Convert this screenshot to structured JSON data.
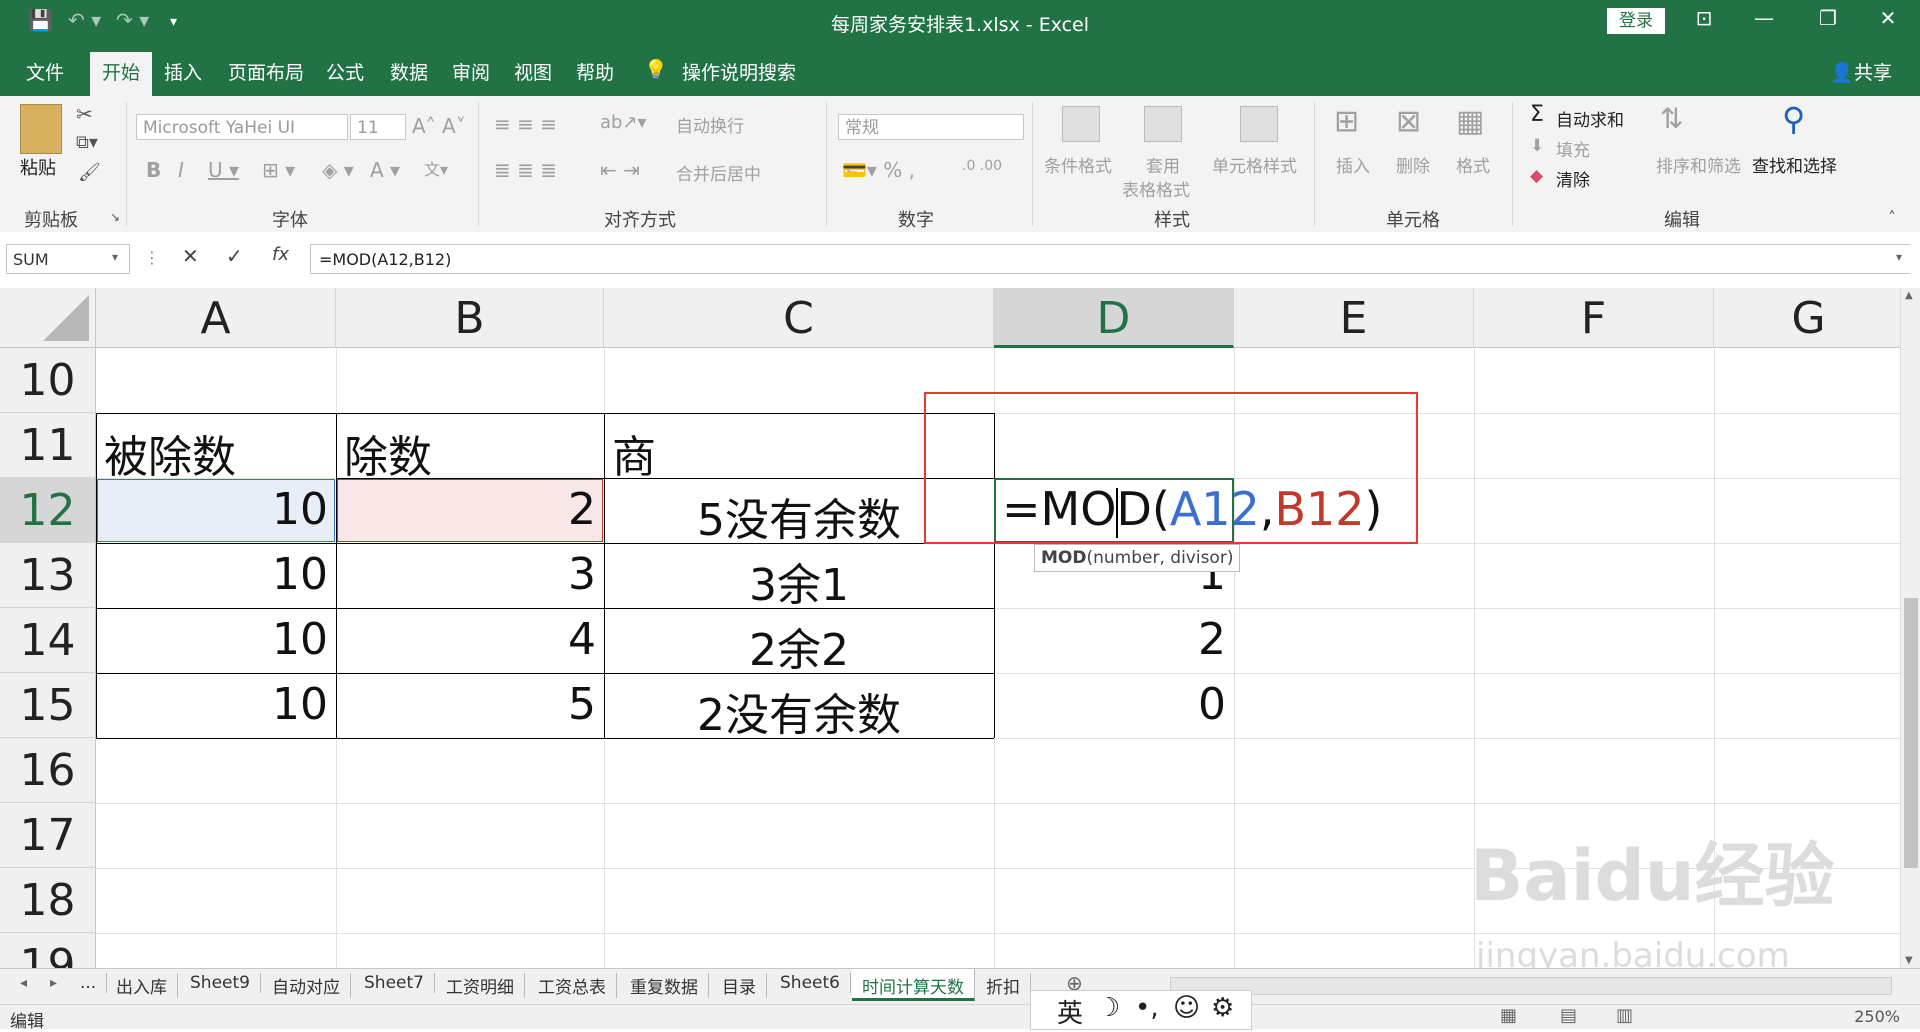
{
  "titlebar": {
    "title": "每周家务安排表1.xlsx  -  Excel",
    "login": "登录"
  },
  "menu": {
    "items": [
      "文件",
      "开始",
      "插入",
      "页面布局",
      "公式",
      "数据",
      "审阅",
      "视图",
      "帮助"
    ],
    "tell_me": "操作说明搜索",
    "share": "共享"
  },
  "ribbon": {
    "paste": "粘贴",
    "font_name": "Microsoft YaHei UI",
    "font_size": "11",
    "wrap_text": "自动换行",
    "merge_center": "合并后居中",
    "number_format": "常规",
    "cond_format": "条件格式",
    "table_format_1": "套用",
    "table_format_2": "表格格式",
    "cell_styles": "单元格样式",
    "insert": "插入",
    "delete": "删除",
    "format": "格式",
    "autosum": "自动求和",
    "fill": "填充",
    "clear": "清除",
    "sort_filter": "排序和筛选",
    "find_select": "查找和选择",
    "groups": {
      "clipboard": "剪贴板",
      "font": "字体",
      "alignment": "对齐方式",
      "number": "数字",
      "styles": "样式",
      "cells": "单元格",
      "editing": "编辑"
    }
  },
  "formula_bar": {
    "name_box": "SUM",
    "formula": "=MOD(A12,B12)"
  },
  "grid": {
    "columns": [
      "A",
      "B",
      "C",
      "D",
      "E",
      "F",
      "G"
    ],
    "rows": [
      "10",
      "11",
      "12",
      "13",
      "14",
      "15",
      "16",
      "17",
      "18",
      "19"
    ],
    "header_row": {
      "a": "被除数",
      "b": "除数",
      "c": "商"
    },
    "data": [
      {
        "a": "10",
        "b": "2",
        "c": "5没有余数",
        "d": ""
      },
      {
        "a": "10",
        "b": "3",
        "c": "3余1",
        "d": "1"
      },
      {
        "a": "10",
        "b": "4",
        "c": "2余2",
        "d": "2"
      },
      {
        "a": "10",
        "b": "5",
        "c": "2没有余数",
        "d": "0"
      }
    ],
    "editing": {
      "eq": "=MOD(",
      "ref1": "A12",
      "comma": ",",
      "ref2": "B12",
      "close": ")"
    },
    "tooltip": {
      "fn": "MOD",
      "args": "(number, divisor)"
    }
  },
  "sheet_tabs": [
    "...",
    "出入库",
    "Sheet9",
    "自动对应",
    "Sheet7",
    "工资明细",
    "工资总表",
    "重复数据",
    "目录",
    "Sheet6",
    "时间计算天数",
    "折扣"
  ],
  "active_tab": "时间计算天数",
  "status": {
    "mode": "编辑",
    "ime": "英",
    "zoom": "250%"
  },
  "watermark": {
    "line1": "Baidu经验",
    "line2": "jingyan.baidu.com"
  },
  "colors": {
    "excel_green": "#217346",
    "ref_blue": "#3a6fd0",
    "ref_red": "#c0392b",
    "highlight": "#e8382f"
  }
}
